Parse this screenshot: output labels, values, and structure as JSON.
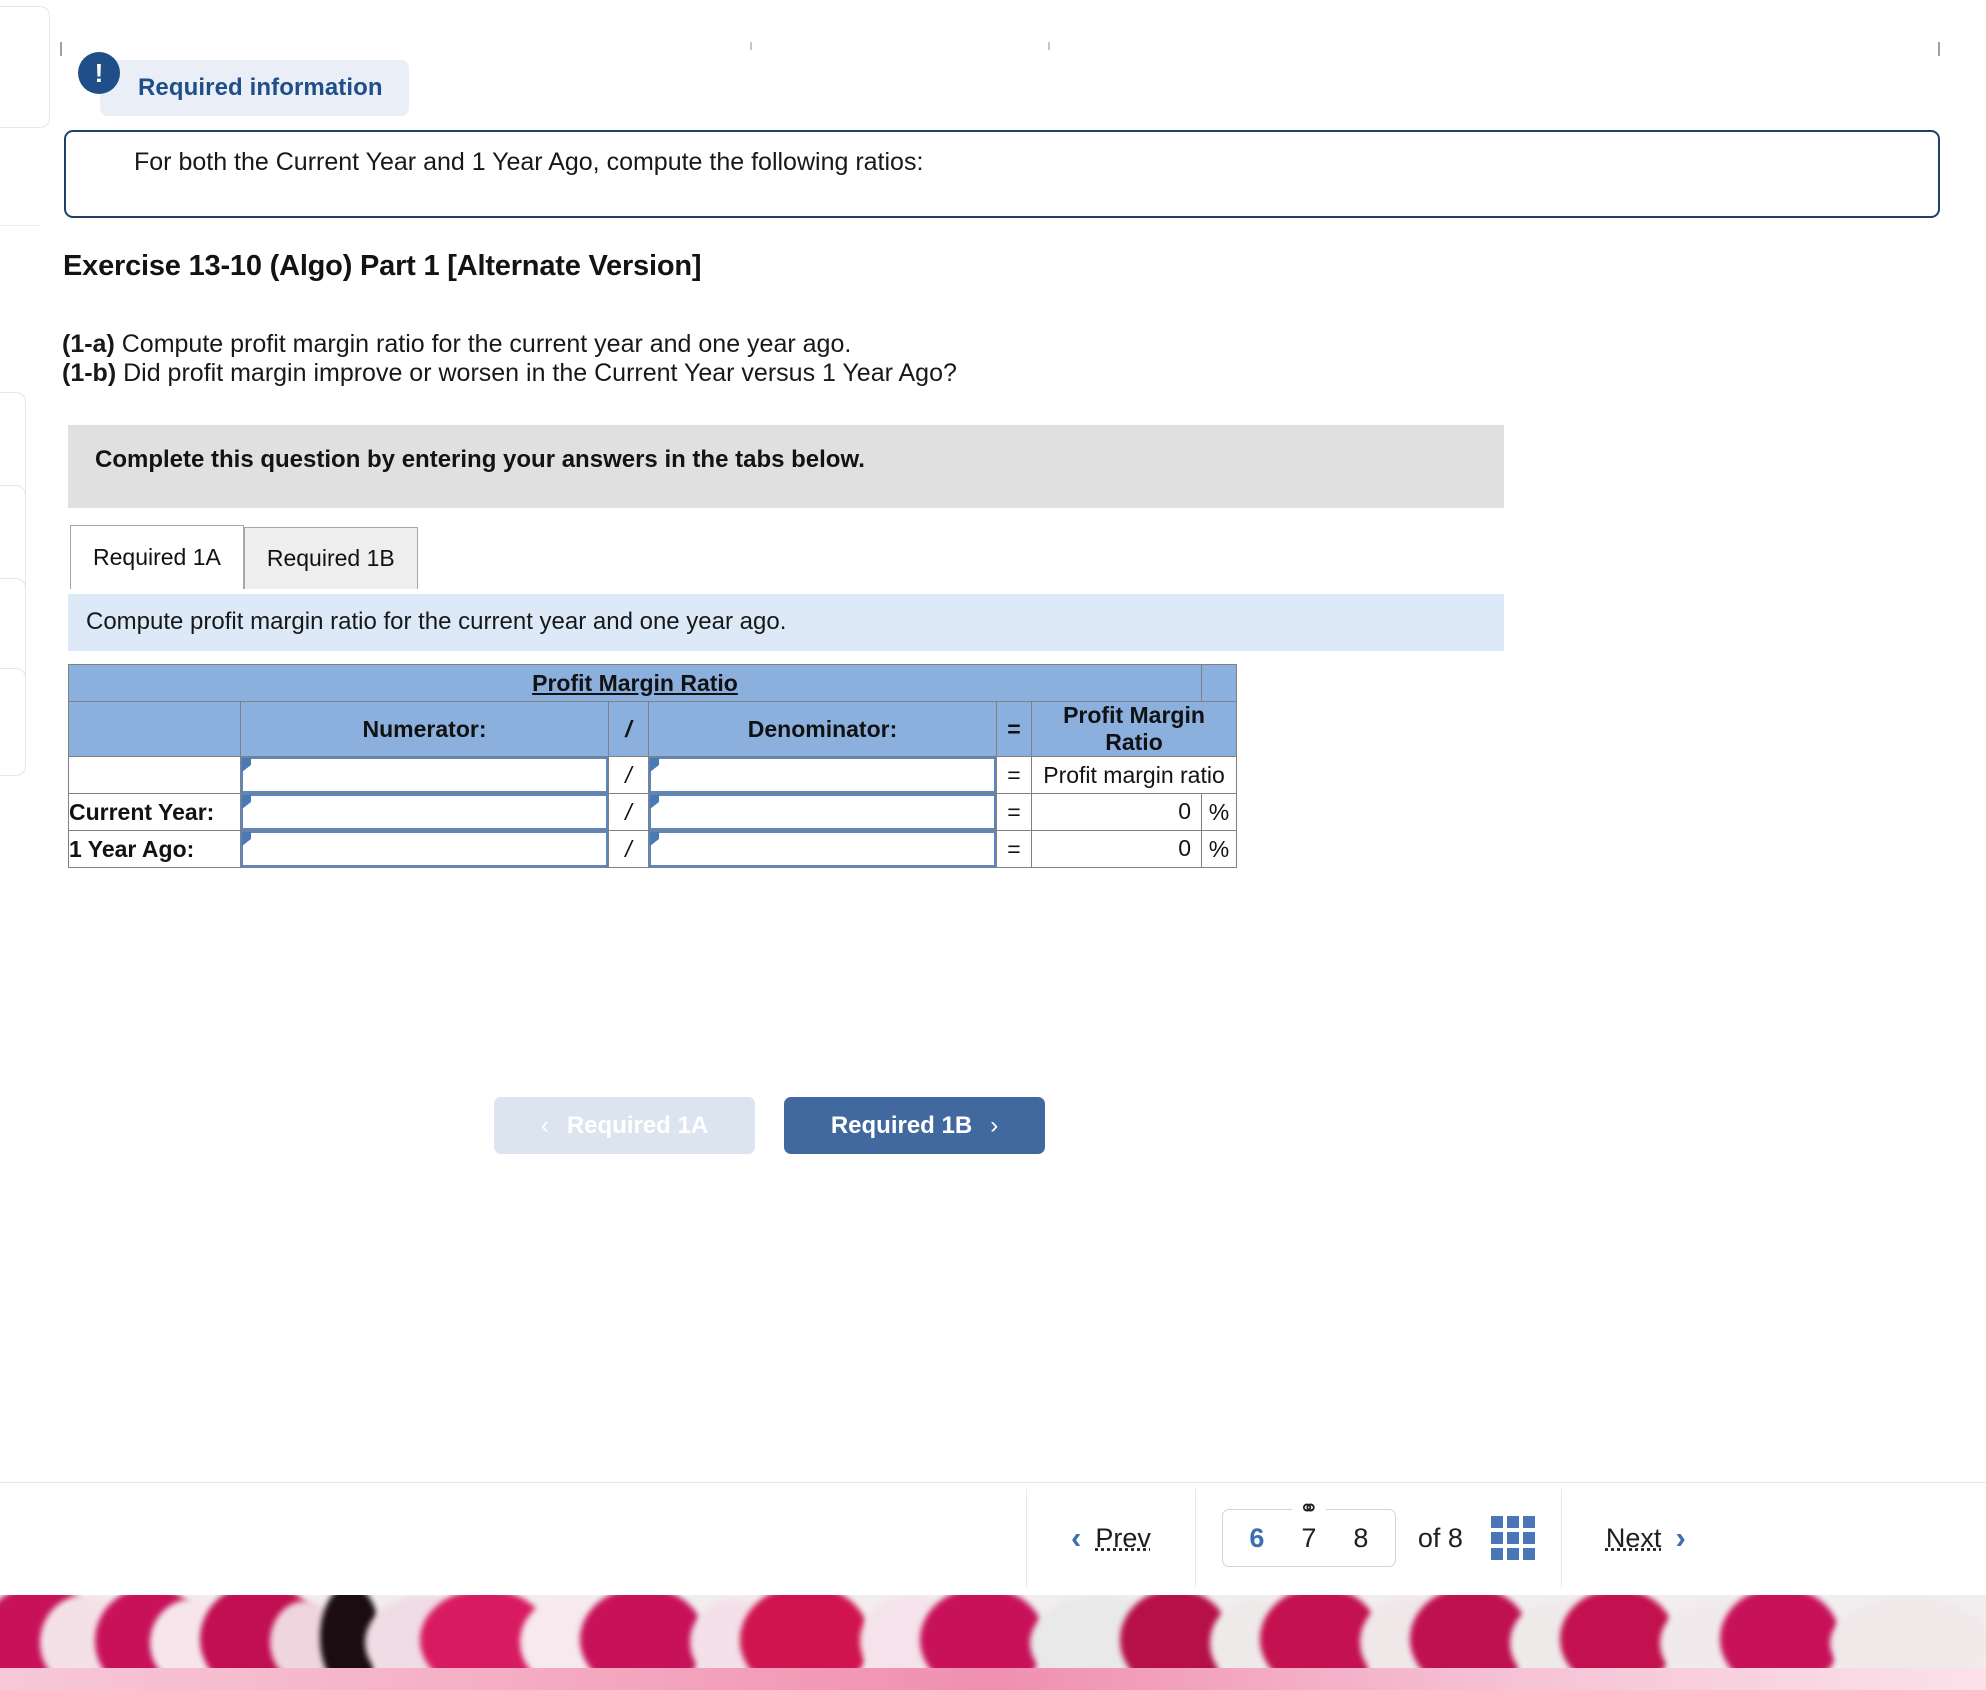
{
  "alert": {
    "icon": "exclamation-icon",
    "badge_label": "Required information",
    "body_text": "For both the Current Year and 1 Year Ago, compute the following ratios:"
  },
  "exercise": {
    "title": "Exercise 13-10 (Algo) Part 1 [Alternate Version]",
    "prompt_a_marker": "(1-a)",
    "prompt_a_text": " Compute profit margin ratio for the current year and one year ago.",
    "prompt_b_marker": "(1-b)",
    "prompt_b_text": " Did profit margin improve or worsen in the Current Year versus 1 Year Ago?"
  },
  "instruction_banner": {
    "text": "Complete this question by entering your answers in the tabs below."
  },
  "tabs": [
    {
      "label": "Required 1A",
      "active": true
    },
    {
      "label": "Required 1B",
      "active": false
    }
  ],
  "sub_banner": {
    "text": "Compute profit margin ratio for the current year and one year ago."
  },
  "worksheet": {
    "title": "Profit Margin Ratio",
    "headers": {
      "blank": "",
      "numerator": "Numerator:",
      "slash": "/",
      "denominator": "Denominator:",
      "equals": "=",
      "result": "Profit Margin Ratio"
    },
    "rows": [
      {
        "label": "",
        "numerator_value": "",
        "slash": "/",
        "denominator_value": "",
        "equals": "=",
        "result_text": "Profit margin ratio",
        "result_value": null,
        "unit": ""
      },
      {
        "label": "Current Year:",
        "numerator_value": "",
        "slash": "/",
        "denominator_value": "",
        "equals": "=",
        "result_text": null,
        "result_value": "0",
        "unit": "%"
      },
      {
        "label": "1 Year Ago:",
        "numerator_value": "",
        "slash": "/",
        "denominator_value": "",
        "equals": "=",
        "result_text": null,
        "result_value": "0",
        "unit": "%"
      }
    ]
  },
  "requirement_nav": {
    "prev_label": "Required 1A",
    "prev_chevron": "‹",
    "next_label": "Required 1B",
    "next_chevron": "›"
  },
  "pagination": {
    "prev_label": "Prev",
    "prev_arrow": "‹",
    "next_label": "Next",
    "next_arrow": "›",
    "pages": [
      "6",
      "7",
      "8"
    ],
    "current_page": "6",
    "of_label": "of  8",
    "link_icon": "⚭",
    "grid_icon": "grid-icon"
  },
  "colors": {
    "brand_navy": "#1f4e88",
    "table_header_blue": "#8cb0dd",
    "sub_banner_blue": "#dde9f7",
    "primary_button": "#41699f",
    "disabled_button": "#dbe4ef",
    "accent_link": "#3d6fb0"
  }
}
